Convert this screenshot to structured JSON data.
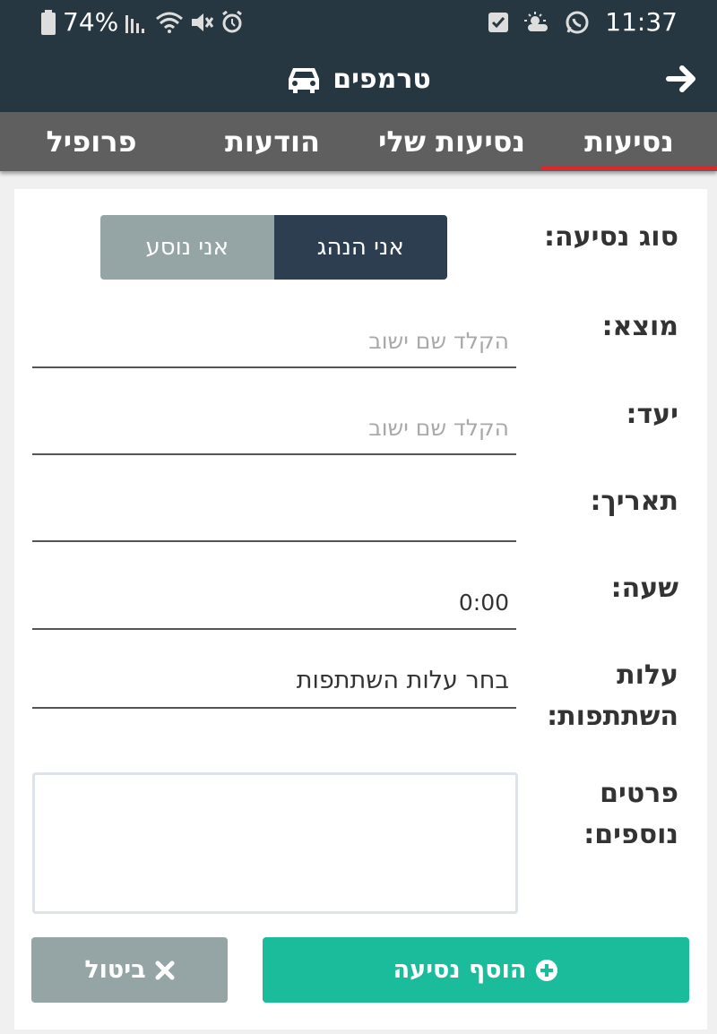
{
  "status_bar": {
    "battery": "74%",
    "time": "11:37",
    "icons": [
      "battery-icon",
      "signal-icon",
      "wifi-icon",
      "mute-icon",
      "alarm-icon",
      "checkbox-icon",
      "weather-icon",
      "whatsapp-icon"
    ]
  },
  "app_bar": {
    "title": "טרמפים",
    "icons": [
      "car-icon",
      "back-arrow-icon"
    ]
  },
  "tabs": [
    {
      "label": "נסיעות",
      "active": true
    },
    {
      "label": "נסיעות שלי",
      "active": false
    },
    {
      "label": "הודעות",
      "active": false
    },
    {
      "label": "פרופיל",
      "active": false
    }
  ],
  "form": {
    "ride_type": {
      "label": "סוג נסיעה:",
      "driver_label": "אני הנהג",
      "passenger_label": "אני נוסע",
      "selected": "driver"
    },
    "origin": {
      "label": "מוצא:",
      "placeholder": "הקלד שם ישוב",
      "value": ""
    },
    "destination": {
      "label": "יעד:",
      "placeholder": "הקלד שם ישוב",
      "value": ""
    },
    "date": {
      "label": "תאריך:",
      "value": ""
    },
    "time": {
      "label": "שעה:",
      "value": "0:00"
    },
    "cost": {
      "label": "עלות השתתפות:",
      "value": "בחר עלות השתתפות"
    },
    "details": {
      "label": "פרטים נוספים:",
      "value": ""
    }
  },
  "buttons": {
    "add_label": "הוסף נסיעה",
    "cancel_label": "ביטול"
  },
  "colors": {
    "header": "#263741",
    "tab_bar": "#5f5f5f",
    "tab_indicator": "#e0262b",
    "driver_selected": "#2c3e50",
    "passenger": "#95a5a6",
    "add_button": "#1abc9c",
    "cancel_button": "#95a5a6"
  }
}
